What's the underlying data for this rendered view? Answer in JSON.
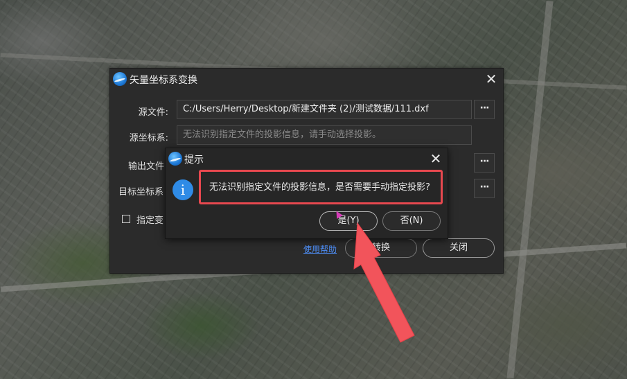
{
  "main_dialog": {
    "title": "矢量坐标系变换",
    "close_glyph": "✕",
    "source_file_label": "源文件:",
    "source_file_value": "C:/Users/Herry/Desktop/新建文件夹 (2)/测试数据/111.dxf",
    "source_crs_label": "源坐标系:",
    "source_crs_placeholder": "无法识别指定文件的投影信息，请手动选择投影。",
    "output_file_label": "输出文件",
    "target_crs_label": "目标坐标系",
    "browse_glyph": "···",
    "specify_checkbox_label": "指定变",
    "help_link": "使用帮助",
    "convert_button": "转换",
    "close_button": "关闭"
  },
  "prompt_dialog": {
    "title": "提示",
    "close_glyph": "✕",
    "info_glyph": "i",
    "message": "无法识别指定文件的投影信息，是否需要手动指定投影?",
    "yes_button": "是(Y)",
    "no_button": "否(N)"
  },
  "colors": {
    "highlight": "#e8484f",
    "arrow": "#f2545b",
    "accent": "#2f8be6"
  }
}
